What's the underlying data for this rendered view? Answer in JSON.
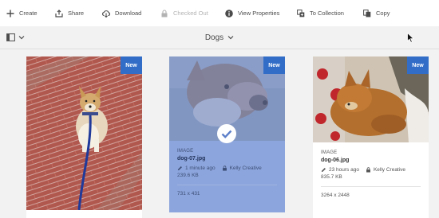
{
  "toolbar": {
    "items": [
      {
        "label": "Create",
        "icon": "plus-icon",
        "disabled": false
      },
      {
        "label": "Share",
        "icon": "share-icon",
        "disabled": false
      },
      {
        "label": "Download",
        "icon": "download-icon",
        "disabled": false
      },
      {
        "label": "Checked Out",
        "icon": "lock-icon",
        "disabled": true
      },
      {
        "label": "View Properties",
        "icon": "info-icon",
        "disabled": false
      },
      {
        "label": "To Collection",
        "icon": "collection-icon",
        "disabled": false
      },
      {
        "label": "Copy",
        "icon": "copy-icon",
        "disabled": false
      }
    ]
  },
  "subbar": {
    "rail_icon": "rail-toggle-icon",
    "folder_title": "Dogs"
  },
  "assets": [
    {
      "badge": "New",
      "selected": false
    },
    {
      "badge": "New",
      "selected": true,
      "type": "IMAGE",
      "filename": "dog-07.jpg",
      "modified": "1 minute ago",
      "owner": "Kelly Creative",
      "size": "239.6 KB",
      "dimensions": "731 x 431"
    },
    {
      "badge": "New",
      "selected": false,
      "type": "IMAGE",
      "filename": "dog-06.jpg",
      "modified": "23 hours ago",
      "owner": "Kelly Creative",
      "size": "835.7 KB",
      "dimensions": "3264 x 2448"
    }
  ],
  "colors": {
    "accent": "#326ec8",
    "selected_card": "#8ca5dc",
    "toolbar_bg": "#ffffff",
    "page_bg": "#f2f2f2"
  }
}
